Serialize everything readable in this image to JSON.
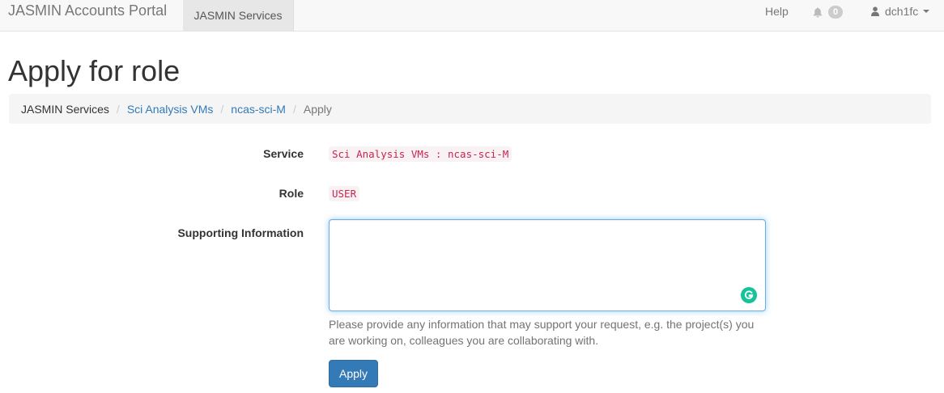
{
  "navbar": {
    "brand": "JASMIN Accounts Portal",
    "services": "JASMIN Services",
    "help": "Help",
    "notification_count": "0",
    "username": "dch1fc"
  },
  "page": {
    "title": "Apply for role"
  },
  "breadcrumb": {
    "items": [
      {
        "label": "JASMIN Services"
      },
      {
        "label": "Sci Analysis VMs"
      },
      {
        "label": "ncas-sci-M"
      },
      {
        "label": "Apply"
      }
    ]
  },
  "form": {
    "service_label": "Service",
    "service_value": "Sci Analysis VMs : ncas-sci-M",
    "role_label": "Role",
    "role_value": "USER",
    "info_label": "Supporting Information",
    "info_value": "",
    "help_text": "Please provide any information that may support your request, e.g. the project(s) you are working on, colleagues you are collaborating with.",
    "apply_label": "Apply"
  },
  "icons": {
    "notifications": "bell-icon",
    "user": "user-icon",
    "grammarly": "grammarly-icon"
  },
  "colors": {
    "link": "#337ab7",
    "primary_button": "#337ab7",
    "code_text": "#c7254e",
    "grammarly": "#15c39a"
  }
}
